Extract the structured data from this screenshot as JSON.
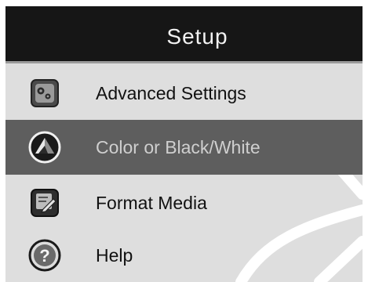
{
  "header": {
    "title": "Setup"
  },
  "menu": {
    "items": [
      {
        "label": "Advanced Settings",
        "icon": "gear-settings-icon",
        "selected": false
      },
      {
        "label": "Color or Black/White",
        "icon": "color-bw-icon",
        "selected": true
      },
      {
        "label": "Format Media",
        "icon": "format-media-icon",
        "selected": false
      },
      {
        "label": "Help",
        "icon": "help-question-icon",
        "selected": false
      }
    ]
  },
  "colors": {
    "title_bar": "#161616",
    "menu_background": "#dedede",
    "selected_row": "#5e5e5e",
    "selected_text": "#cfcfcf"
  }
}
